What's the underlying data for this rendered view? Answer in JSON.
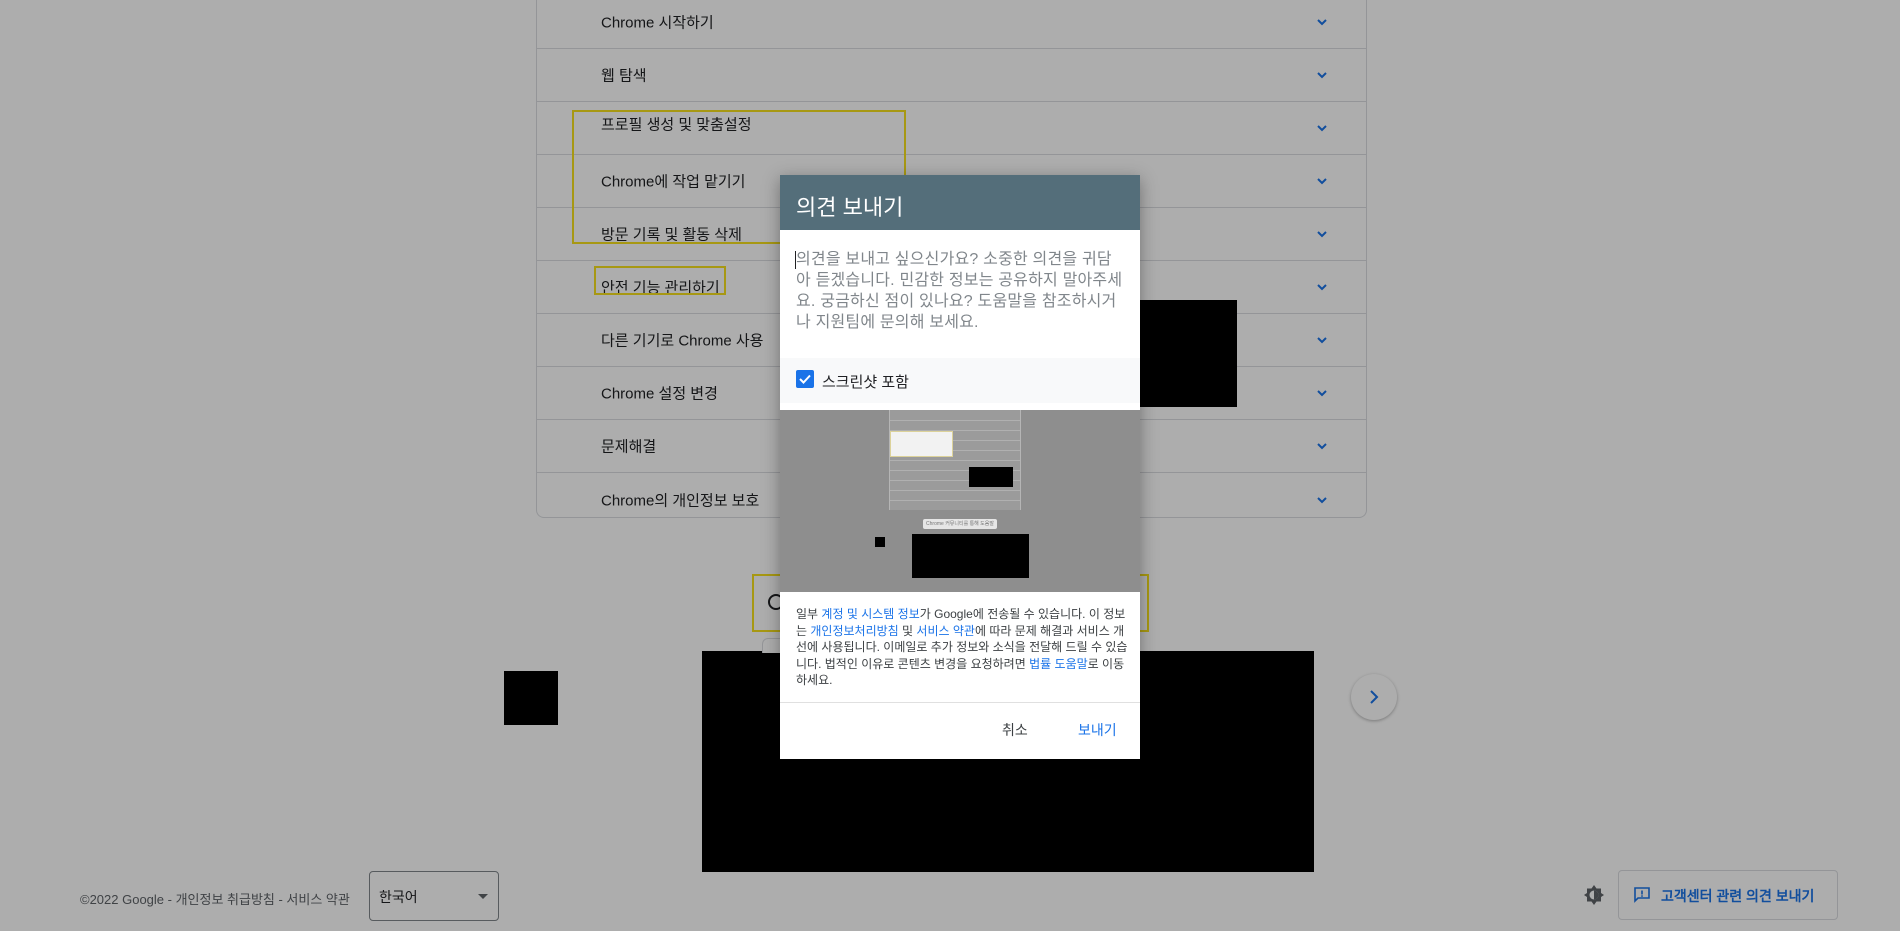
{
  "accordion": {
    "items": [
      {
        "label": "Chrome 시작하기"
      },
      {
        "label": "웹 탐색"
      },
      {
        "label": "프로필 생성 및 맞춤설정"
      },
      {
        "label": "Chrome에 작업 맡기기"
      },
      {
        "label": "방문 기록 및 활동 삭제"
      },
      {
        "label": "안전 기능 관리하기"
      },
      {
        "label": "다른 기기로 Chrome 사용"
      },
      {
        "label": "Chrome 설정 변경"
      },
      {
        "label": "문제해결"
      },
      {
        "label": "Chrome의 개인정보 보호"
      }
    ]
  },
  "footer": {
    "copyright": "©2022 Google - 개인정보 취급방침 - 서비스 약관",
    "language": "한국어",
    "feedback_label": "고객센터 관련 의견 보내기"
  },
  "dialog": {
    "title": "의견 보내기",
    "placeholder": "의견을 보내고 싶으신가요? 소중한 의견을 귀담아 듣겠습니다. 민감한 정보는 공유하지 말아주세요. 궁금하신 점이 있나요? 도움말을 참조하시거나 지원팀에 문의해 보세요.",
    "screenshot_checkbox_label": "스크린샷 포함",
    "screenshot_checked": true,
    "preview_pill_text": "Chrome 커뮤니티를 통해 도움말",
    "legal": {
      "part1": "일부 ",
      "link1": "계정 및 시스템 정보",
      "part2": "가 Google에 전송될 수 있습니다. 이 정보는 ",
      "link2": "개인정보처리방침",
      "part3": " 및 ",
      "link3": "서비스 약관",
      "part4": "에 따라 문제 해결과 서비스 개선에 사용됩니다. 이메일로 추가 정보와 소식을 전달해 드릴 수 있습니다. 법적인 이유로 콘텐츠 변경을 요청하려면 ",
      "link4": "법률 도움말",
      "part5": "로 이동하세요."
    },
    "cancel_label": "취소",
    "send_label": "보내기"
  },
  "colors": {
    "dialog_header": "#546e7a",
    "accent": "#1a73e8",
    "highlight": "#f7e11c",
    "scrim": "rgba(0,0,0,0.32)"
  }
}
